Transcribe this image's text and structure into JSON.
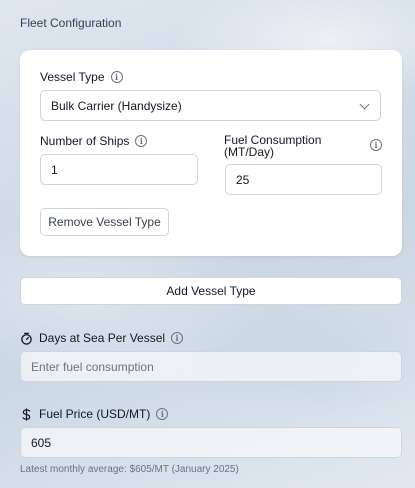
{
  "section_title": "Fleet Configuration",
  "vessel_card": {
    "vessel_type_label": "Vessel Type",
    "vessel_type_value": "Bulk Carrier (Handysize)",
    "ships_label": "Number of Ships",
    "ships_value": "1",
    "fuel_label_line1": "Fuel Consumption",
    "fuel_label_line2": "(MT/Day)",
    "fuel_value": "25",
    "remove_button": "Remove Vessel Type"
  },
  "add_button": "Add Vessel Type",
  "days_at_sea": {
    "label": "Days at Sea Per Vessel",
    "placeholder": "Enter fuel consumption",
    "icon": "timer-icon"
  },
  "fuel_price": {
    "label": "Fuel Price (USD/MT)",
    "value": "605",
    "icon": "dollar-icon",
    "hint": "Latest monthly average: $605/MT (January 2025)"
  },
  "icons": {
    "info": "info-icon",
    "select": "chevron-down-icon"
  }
}
